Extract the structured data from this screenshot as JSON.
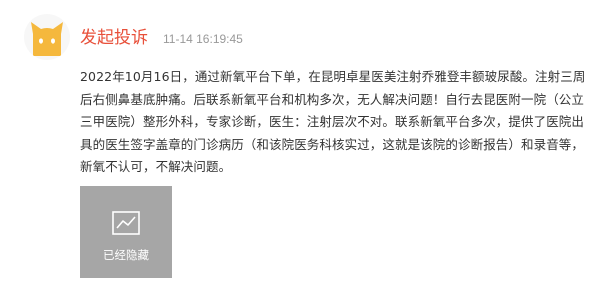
{
  "post": {
    "avatar_icon": "cat-avatar-icon",
    "action": "发起投诉",
    "time": "11-14 16:19:45",
    "content": "2022年10月16日，通过新氧平台下单，在昆明卓星医美注射乔雅登丰额玻尿酸。注射三周后右侧鼻基底肿痛。后联系新氧平台和机构多次，无人解决问题！自行去昆医附一院（公立三甲医院）整形外科，专家诊断，医生：注射层次不对。联系新氧平台多次，提供了医院出具的医生签字盖章的门诊病历（和该院医务科核实过，这就是该院的诊断报告）和录音等，新氧不认可，不解决问题。",
    "attachment": {
      "icon": "image-chart-icon",
      "label": "已经隐藏"
    }
  },
  "colors": {
    "accent": "#e8503a",
    "avatar": "#f5b83d",
    "thumbnail": "#a6a6a6"
  }
}
